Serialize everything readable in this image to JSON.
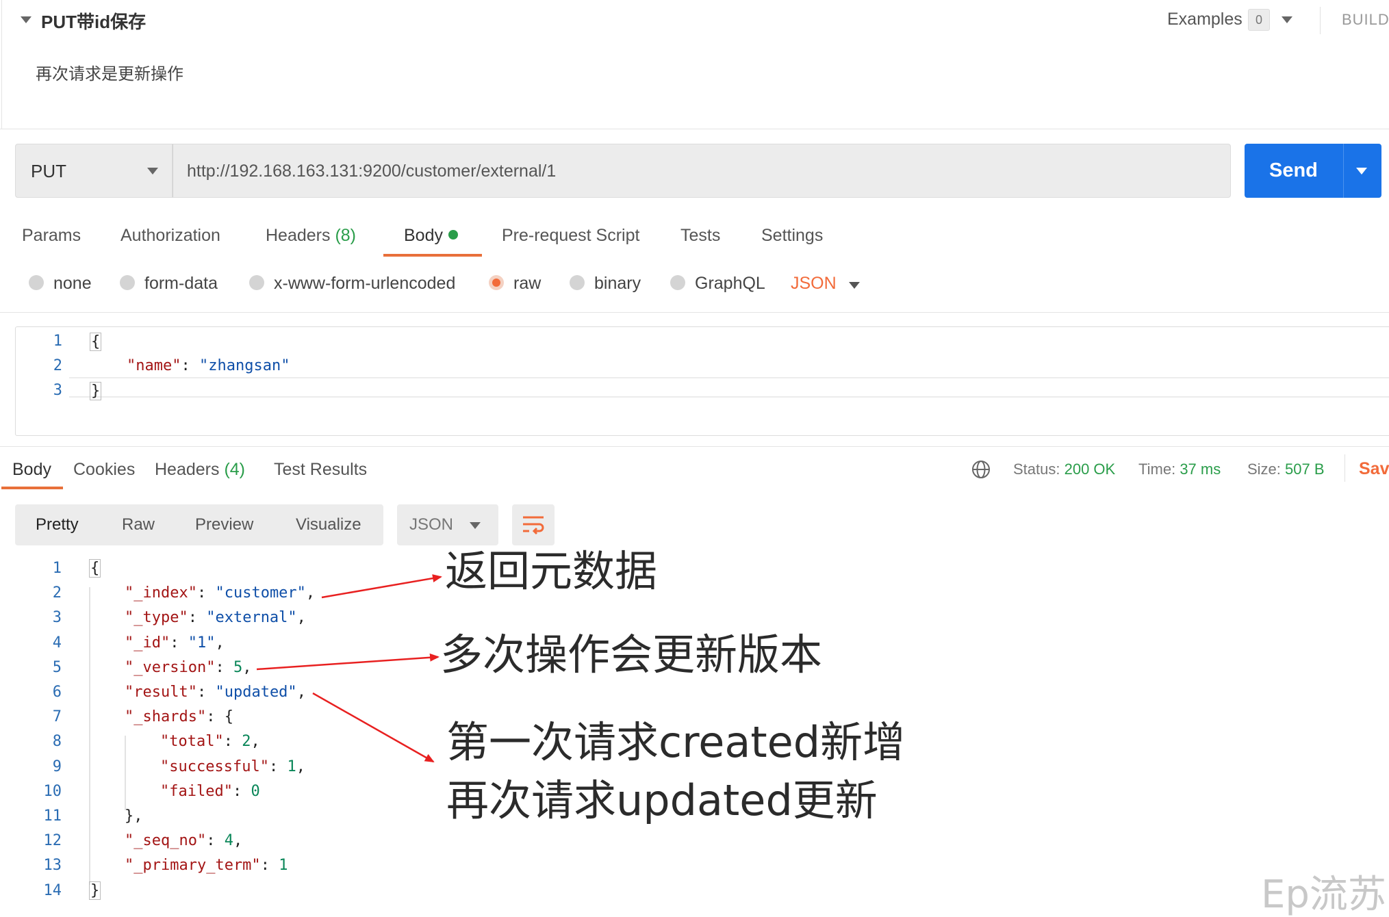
{
  "header": {
    "title": "PUT带id保存",
    "description": "再次请求是更新操作",
    "examples_label": "Examples",
    "examples_count": "0",
    "build_label": "BUILD"
  },
  "request": {
    "method": "PUT",
    "url": "http://192.168.163.131:9200/customer/external/1",
    "send_label": "Send"
  },
  "request_tabs": {
    "params": "Params",
    "authorization": "Authorization",
    "headers": "Headers",
    "headers_count": "(8)",
    "body": "Body",
    "pre_request": "Pre-request Script",
    "tests": "Tests",
    "settings": "Settings"
  },
  "body_types": {
    "none": "none",
    "form_data": "form-data",
    "urlencoded": "x-www-form-urlencoded",
    "raw": "raw",
    "binary": "binary",
    "graphql": "GraphQL",
    "selected_format": "JSON"
  },
  "request_body": {
    "line_numbers": [
      "1",
      "2",
      "3"
    ],
    "open_brace": "{",
    "key": "\"name\"",
    "colon": ": ",
    "value": "\"zhangsan\"",
    "close_brace": "}"
  },
  "response_tabs": {
    "body": "Body",
    "cookies": "Cookies",
    "headers": "Headers",
    "headers_count": "(4)",
    "test_results": "Test Results"
  },
  "response_status": {
    "status_label": "Status:",
    "status_value": "200 OK",
    "time_label": "Time:",
    "time_value": "37 ms",
    "size_label": "Size:",
    "size_value": "507 B",
    "save_label": "Sav"
  },
  "response_view": {
    "pretty": "Pretty",
    "raw": "Raw",
    "preview": "Preview",
    "visualize": "Visualize",
    "format": "JSON"
  },
  "response_body": {
    "line_numbers": [
      "1",
      "2",
      "3",
      "4",
      "5",
      "6",
      "7",
      "8",
      "9",
      "10",
      "11",
      "12",
      "13",
      "14"
    ],
    "lines": [
      {
        "key": "",
        "value": "",
        "tail": "{"
      },
      {
        "key": "\"_index\"",
        "value": "\"customer\"",
        "tail": ","
      },
      {
        "key": "\"_type\"",
        "value": "\"external\"",
        "tail": ","
      },
      {
        "key": "\"_id\"",
        "value": "\"1\"",
        "tail": ","
      },
      {
        "key": "\"_version\"",
        "value": "5",
        "tail": ","
      },
      {
        "key": "\"result\"",
        "value": "\"updated\"",
        "tail": ","
      },
      {
        "key": "\"_shards\"",
        "value": "{",
        "tail": ""
      },
      {
        "key": "\"total\"",
        "value": "2",
        "tail": ","
      },
      {
        "key": "\"successful\"",
        "value": "1",
        "tail": ","
      },
      {
        "key": "\"failed\"",
        "value": "0",
        "tail": ""
      },
      {
        "key": "",
        "value": "",
        "tail": "},"
      },
      {
        "key": "\"_seq_no\"",
        "value": "4",
        "tail": ","
      },
      {
        "key": "\"_primary_term\"",
        "value": "1",
        "tail": ""
      },
      {
        "key": "",
        "value": "",
        "tail": "}"
      }
    ]
  },
  "annotations": {
    "metadata": "返回元数据",
    "version": "多次操作会更新版本",
    "result_line1": "第一次请求created新增",
    "result_line2": "再次请求updated更新",
    "arrow_color": "#e82020"
  },
  "watermark": "Ep流苏",
  "colors": {
    "accent": "#f26b3a",
    "send_blue": "#1a73e8",
    "success_green": "#2a9d4a"
  }
}
